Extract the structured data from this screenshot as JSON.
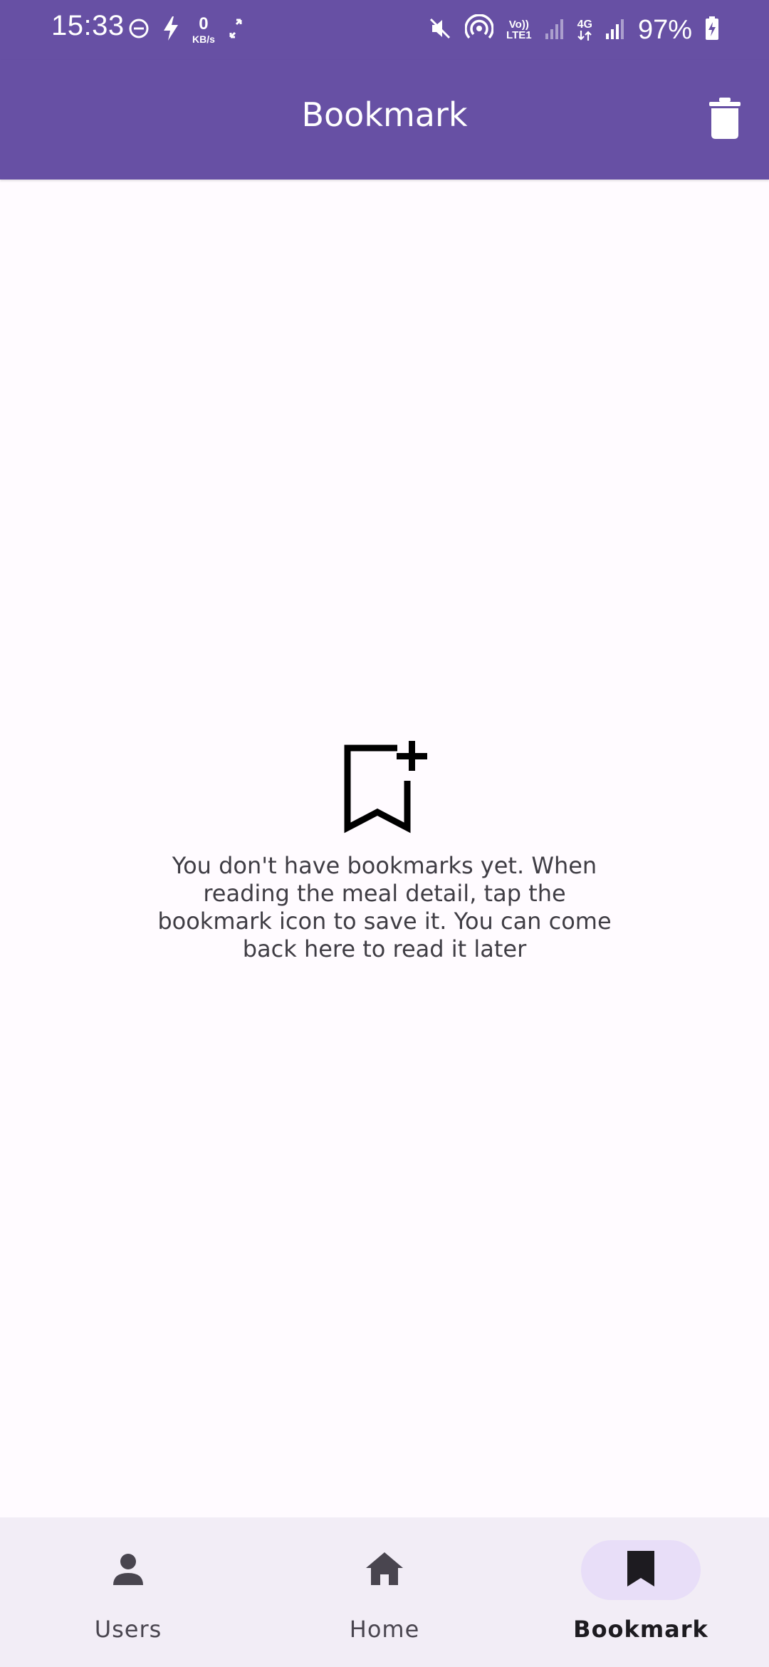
{
  "status_bar": {
    "time": "15:33",
    "data_speed_value": "0",
    "data_speed_unit": "KB/s",
    "lte_top": "Vo))",
    "lte_bottom": "LTE1",
    "network_type": "4G",
    "battery_percent": "97%",
    "icons": [
      "dnd-icon",
      "flash-icon",
      "data-speed-icon",
      "sync-icon",
      "mute-icon",
      "hotspot-icon",
      "volte-icon",
      "signal-icon",
      "4g-icon",
      "signal-icon",
      "battery-charging-icon"
    ]
  },
  "app_bar": {
    "title": "Bookmark",
    "action_icon": "trash-icon"
  },
  "empty_state": {
    "icon": "bookmark-add-icon",
    "message": "You don't have bookmarks yet. When reading the meal detail, tap the bookmark icon to save it. You can come back here to read it later"
  },
  "bottom_nav": {
    "items": [
      {
        "label": "Users",
        "icon": "person-icon",
        "selected": false
      },
      {
        "label": "Home",
        "icon": "home-icon",
        "selected": false
      },
      {
        "label": "Bookmark",
        "icon": "bookmark-icon",
        "selected": true
      }
    ]
  },
  "colors": {
    "primary": "#6750a4",
    "background": "#fffbff",
    "nav_background": "#f2edf6",
    "nav_indicator": "#e8def8",
    "on_surface_variant": "#49454f"
  }
}
